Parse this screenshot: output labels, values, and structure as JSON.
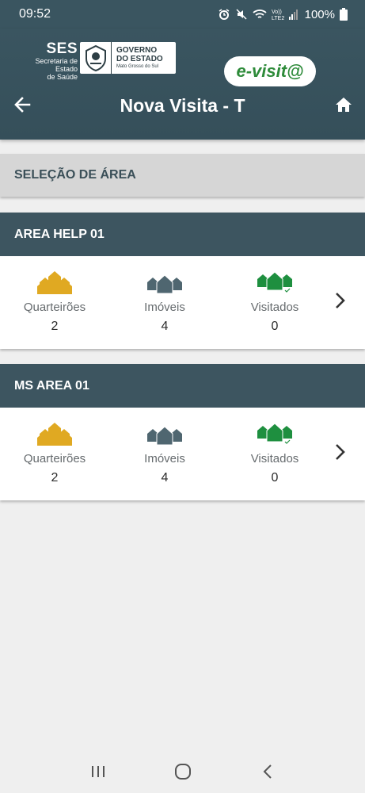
{
  "status_bar": {
    "time": "09:52",
    "network": "Vo))\nLTE2",
    "battery": "100%"
  },
  "brand": {
    "ses_title": "SES",
    "ses_sub1": "Secretaria de Estado",
    "ses_sub2": "de Saúde",
    "gov_line1": "GOVERNO",
    "gov_line2": "DO ESTADO",
    "gov_line3": "Mato Grosso do Sul",
    "app_logo": "e-visit@"
  },
  "header": {
    "title": "Nova Visita - T"
  },
  "section": {
    "title": "SELEÇÃO DE ÁREA"
  },
  "labels": {
    "quarteiroes": "Quarteirões",
    "imoveis": "Imóveis",
    "visitados": "Visitados"
  },
  "areas": [
    {
      "name": "AREA HELP 01",
      "quarteiroes": "2",
      "imoveis": "4",
      "visitados": "0"
    },
    {
      "name": "MS AREA 01",
      "quarteiroes": "2",
      "imoveis": "4",
      "visitados": "0"
    }
  ],
  "colors": {
    "header_bg": "#3a5560",
    "quarteiroes_icon": "#e0a922",
    "imoveis_icon": "#4f6670",
    "visitados_icon": "#1e8f3f"
  },
  "icons": {
    "back": "arrow-left-icon",
    "home": "home-icon",
    "quarteiroes": "houses-cluster-icon",
    "imoveis": "houses-row-icon",
    "visitados": "houses-visited-icon",
    "chevron": "chevron-right-icon"
  }
}
